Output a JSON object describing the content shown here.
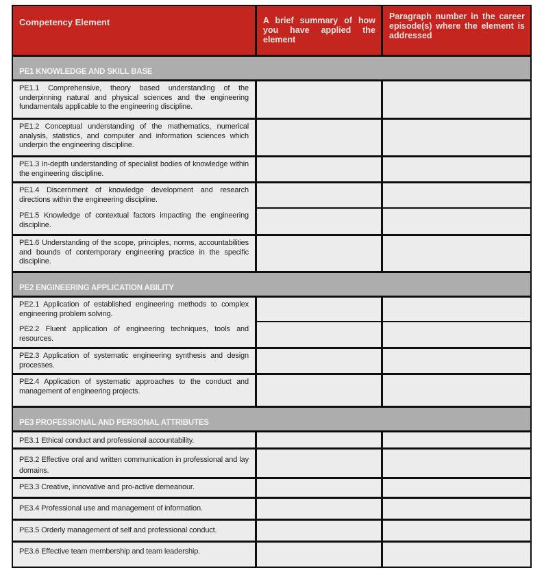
{
  "table": {
    "headers": {
      "competency": "Competency Element",
      "summary": "A brief summary of how you have applied the element",
      "paragraph": "Paragraph number in the career episode(s) where the element is addressed"
    },
    "colors": {
      "header_bg": "#c4251f",
      "section_bg": "#adadad",
      "cell_bg": "#ececec"
    },
    "sections": [
      {
        "title": "PE1 KNOWLEDGE AND SKILL BASE",
        "items": [
          {
            "text": "PE1.1 Comprehensive, theory based understanding of the underpinning natural and physical sciences and the engineering fundamentals applicable to the engineering discipline.",
            "summary": "",
            "paragraph": ""
          },
          {
            "text": "PE1.2 Conceptual understanding of the mathematics, numerical analysis, statistics, and computer and information sciences which underpin the engineering discipline.",
            "summary": "",
            "paragraph": ""
          },
          {
            "text": "PE1.3 In-depth understanding of specialist bodies of knowledge within the engineering discipline.",
            "summary": "",
            "paragraph": ""
          },
          {
            "text": "PE1.4 Discernment of knowledge development and research directions within the engineering discipline.",
            "summary": "",
            "paragraph": ""
          },
          {
            "text": "PE1.5 Knowledge of contextual factors impacting the engineering discipline.",
            "summary": "",
            "paragraph": ""
          },
          {
            "text": "PE1.6 Understanding of the scope, principles, norms, accountabilities and bounds of contemporary engineering practice in the specific discipline.",
            "summary": "",
            "paragraph": ""
          }
        ]
      },
      {
        "title": "PE2 ENGINEERING APPLICATION ABILITY",
        "items": [
          {
            "text": "PE2.1 Application of established engineering methods to complex engineering problem solving.",
            "summary": "",
            "paragraph": ""
          },
          {
            "text": "PE2.2 Fluent application of engineering techniques, tools and resources.",
            "summary": "",
            "paragraph": ""
          },
          {
            "text": "PE2.3 Application of systematic engineering synthesis and design processes.",
            "summary": "",
            "paragraph": ""
          },
          {
            "text": "PE2.4 Application of systematic approaches to the conduct and management of engineering projects.",
            "summary": "",
            "paragraph": ""
          }
        ]
      },
      {
        "title": "PE3 PROFESSIONAL AND PERSONAL ATTRIBUTES",
        "items": [
          {
            "text": "PE3.1 Ethical conduct and professional accountability.",
            "summary": "",
            "paragraph": ""
          },
          {
            "text": "PE3.2 Effective oral and written communication in professional and lay domains.",
            "summary": "",
            "paragraph": ""
          },
          {
            "text": "PE3.3 Creative, innovative and pro-active demeanour.",
            "summary": "",
            "paragraph": ""
          },
          {
            "text": "PE3.4 Professional use and management of information.",
            "summary": "",
            "paragraph": ""
          },
          {
            "text": "PE3.5 Orderly management of self and professional conduct.",
            "summary": "",
            "paragraph": ""
          },
          {
            "text": "PE3.6 Effective team membership and team leadership.",
            "summary": "",
            "paragraph": ""
          }
        ]
      }
    ]
  }
}
